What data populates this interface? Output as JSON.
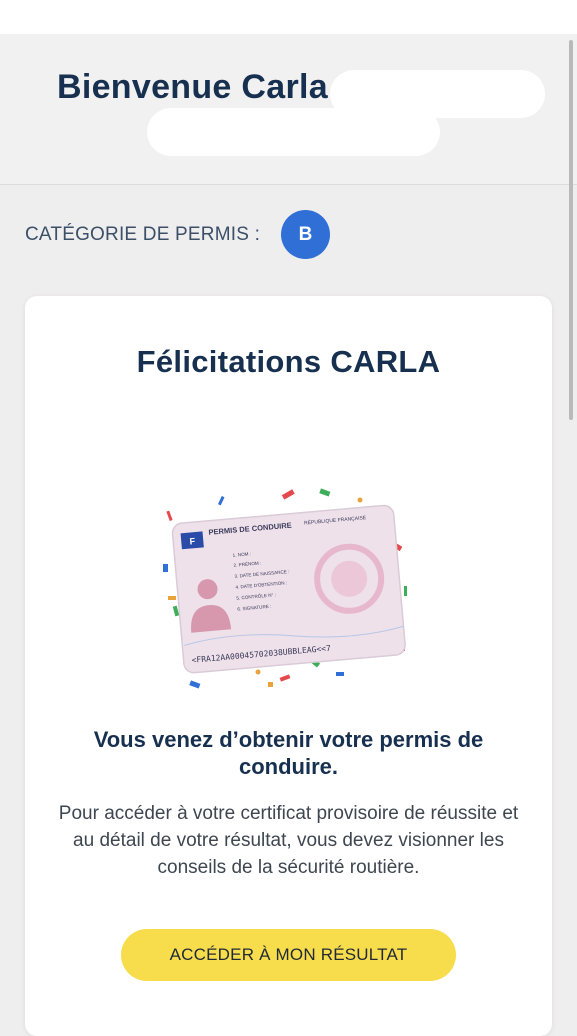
{
  "header": {
    "welcome_text": "Bienvenue Carla"
  },
  "permit_category": {
    "label": "CATÉGORIE DE PERMIS :",
    "value": "B"
  },
  "card": {
    "title": "Félicitations CARLA",
    "license_image": {
      "header_text": "PERMIS DE CONDUIRE",
      "country_text": "RÉPUBLIQUE FRANÇAISE",
      "country_code": "F",
      "fields": [
        "1. NOM :",
        "2. PRÉNOM :",
        "3. DATE DE NAISSANCE :",
        "4. DATE D'OBTENTION :",
        "5. CONTRÔLE N° :",
        "6. SIGNATURE :"
      ],
      "mrz": "<FRA12AA00045702038UBBLEAG<<7"
    },
    "subtitle": "Vous venez d’obtenir votre permis de conduire.",
    "description": "Pour accéder à votre certificat provisoire de réussite et au détail de votre résultat, vous devez visionner les conseils de la sécurité routière.",
    "cta_label": "ACCÉDER À MON RÉSULTAT"
  },
  "colors": {
    "title": "#17304f",
    "badge": "#2f6fd6",
    "cta": "#f7dc4b",
    "background": "#efeeee"
  }
}
